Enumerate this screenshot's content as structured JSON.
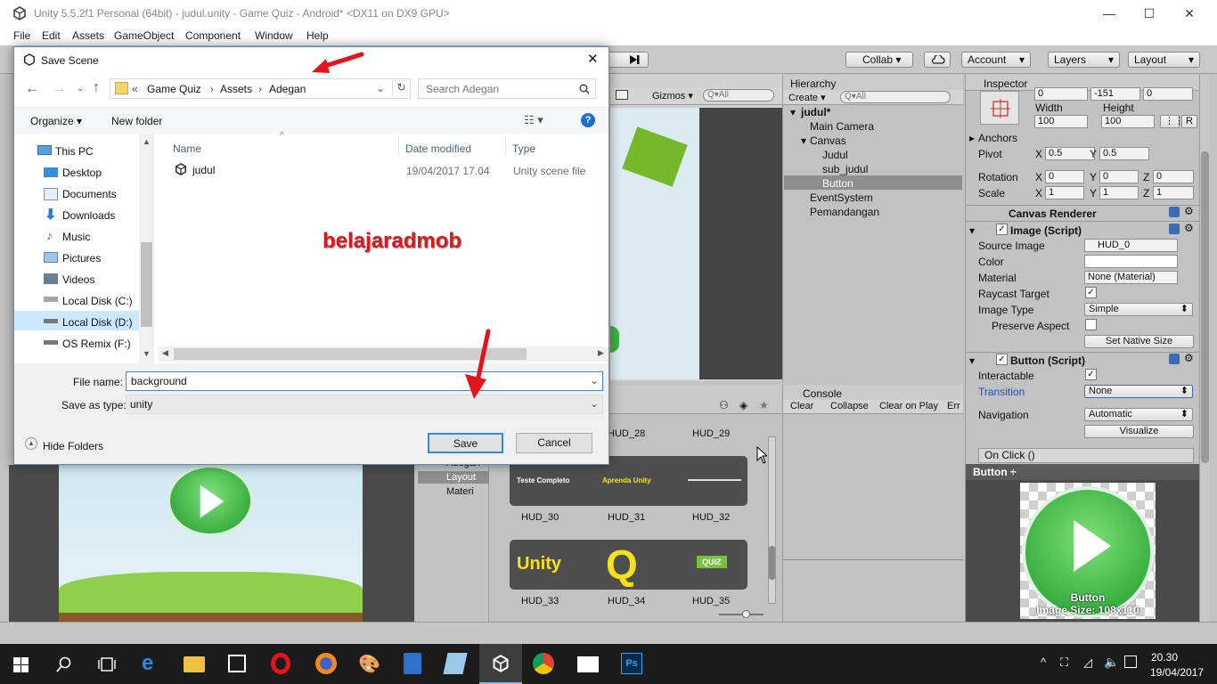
{
  "window": {
    "title": "Unity 5.5.2f1 Personal (64bit) - judul.unity - Game Quiz - Android* <DX11 on DX9 GPU>",
    "min": "—",
    "max": "☐",
    "close": "✕"
  },
  "menu": [
    "File",
    "Edit",
    "Assets",
    "GameObject",
    "Component",
    "Window",
    "Help"
  ],
  "toolbar": {
    "collab": "Collab ▾",
    "account": "Account",
    "layers": "Layers",
    "layout": "Layout"
  },
  "scene": {
    "gizmos": "Gizmos ▾",
    "search": "Q▾All"
  },
  "hierarchy": {
    "tab": "Hierarchy",
    "create": "Create ▾",
    "search": "Q▾All",
    "scene": "judul*",
    "items": [
      "Main Camera",
      "Canvas",
      "Judul",
      "sub_judul",
      "Button",
      "EventSystem",
      "Pemandangan"
    ]
  },
  "console": {
    "tab": "Console",
    "buttons": [
      "Clear",
      "Collapse",
      "Clear on Play",
      "Err"
    ]
  },
  "inspector": {
    "tab": "Inspector",
    "posrow": [
      "0",
      "-151",
      "0"
    ],
    "width_label": "Width",
    "height_label": "Height",
    "width": "100",
    "height": "100",
    "btn_r": "R",
    "anchors": "Anchors",
    "pivot_label": "Pivot",
    "pivot_x": "0.5",
    "pivot_y": "0.5",
    "rotation_label": "Rotation",
    "rot": [
      "0",
      "0",
      "0"
    ],
    "scale_label": "Scale",
    "scale": [
      "1",
      "1",
      "1"
    ],
    "x": "X",
    "y": "Y",
    "z": "Z",
    "canvas_renderer": "Canvas Renderer",
    "image_script": "Image (Script)",
    "source_image_label": "Source Image",
    "source_image": "HUD_0",
    "color_label": "Color",
    "material_label": "Material",
    "material": "None (Material)",
    "raycast_label": "Raycast Target",
    "image_type_label": "Image Type",
    "image_type": "Simple",
    "preserve_label": "Preserve Aspect",
    "native_size": "Set Native Size",
    "button_script": "Button (Script)",
    "interactable_label": "Interactable",
    "transition_label": "Transition",
    "transition": "None",
    "navigation_label": "Navigation",
    "navigation": "Automatic",
    "visualize": "Visualize",
    "onclick": "On Click ()",
    "preview_title": "Button ÷",
    "preview_name": "Button",
    "preview_size": "Image Size: 108x110"
  },
  "project": {
    "tree": [
      "Adegan",
      "Layout",
      "Materi"
    ],
    "hud": [
      "HUD_28",
      "HUD_29",
      "HUD_30",
      "HUD_31",
      "HUD_32",
      "HUD_33",
      "HUD_34",
      "HUD_35"
    ],
    "thumb_text": [
      "Teste Completo",
      "Aprenda Unity",
      "Unity",
      "Q",
      "QUIZ"
    ]
  },
  "dialog": {
    "title": "Save Scene",
    "close": "✕",
    "breadcrumb": [
      "«",
      "Game Quiz",
      "›",
      "Assets",
      "›",
      "Adegan"
    ],
    "search_placeholder": "Search Adegan",
    "organize": "Organize ▾",
    "new_folder": "New folder",
    "nav": [
      "This PC",
      "Desktop",
      "Documents",
      "Downloads",
      "Music",
      "Pictures",
      "Videos",
      "Local Disk (C:)",
      "Local Disk (D:)",
      "OS Remix (F:)"
    ],
    "columns": [
      "Name",
      "Date modified",
      "Type"
    ],
    "files": [
      {
        "name": "judul",
        "date": "19/04/2017 17.04",
        "type": "Unity scene file"
      }
    ],
    "watermark": "belajaradmob",
    "file_name_label": "File name:",
    "file_name": "background",
    "save_type_label": "Save as type:",
    "save_type": "unity",
    "hide_folders": "Hide Folders",
    "save": "Save",
    "cancel": "Cancel"
  },
  "taskbar": {
    "time": "20.30",
    "date": "19/04/2017"
  }
}
